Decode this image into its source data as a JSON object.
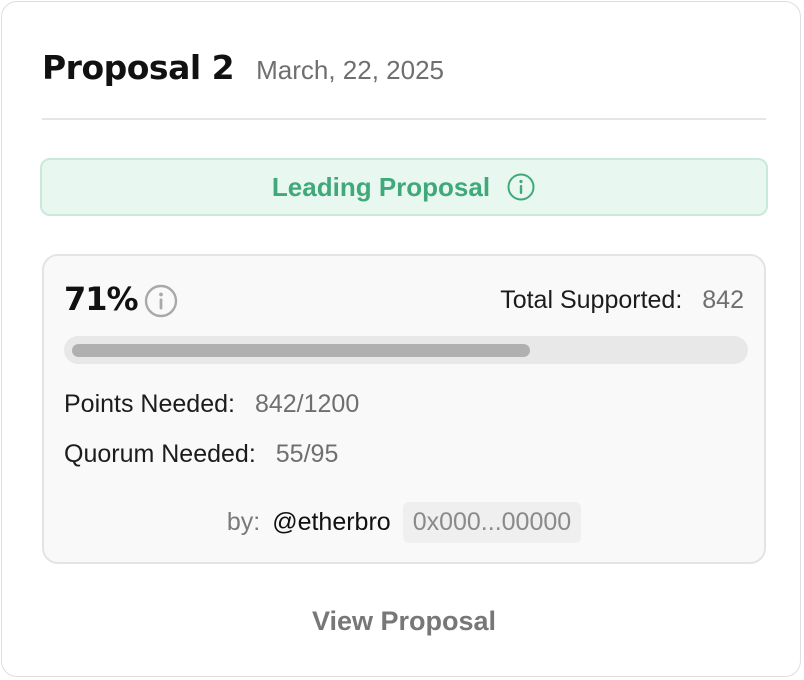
{
  "header": {
    "title": "Proposal 2",
    "date": "March, 22, 2025"
  },
  "status": {
    "label": "Leading Proposal",
    "icon": "info-icon",
    "color": "#3fa97a",
    "background": "#e9f7f1"
  },
  "stats": {
    "percent_label": "71%",
    "progress_fraction": 0.71,
    "info_icon": "info-icon",
    "total_supported_label": "Total Supported:",
    "total_supported_value": "842",
    "points_needed_label": "Points Needed:",
    "points_needed_value": "842/1200",
    "quorum_needed_label": "Quorum Needed:",
    "quorum_needed_value": "55/95"
  },
  "author": {
    "by_label": "by:",
    "handle": "@etherbro",
    "address": "0x000...00000"
  },
  "actions": {
    "view_label": "View Proposal"
  }
}
